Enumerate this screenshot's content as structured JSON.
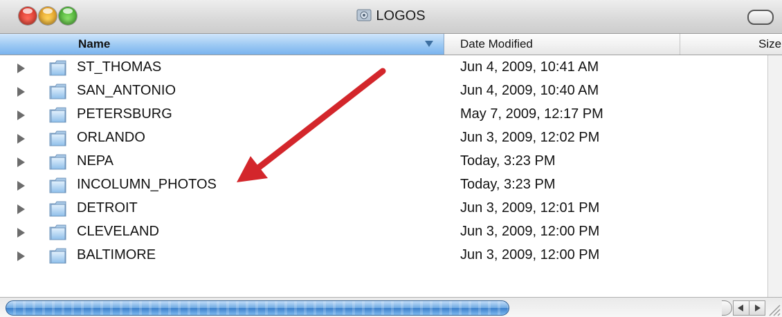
{
  "window": {
    "title": "LOGOS",
    "title_icon": "folder-window-icon"
  },
  "columns": {
    "name": "Name",
    "date_modified": "Date Modified",
    "size": "Size"
  },
  "rows": [
    {
      "name": "ST_THOMAS",
      "date": "Jun 4, 2009, 10:41 AM"
    },
    {
      "name": "SAN_ANTONIO",
      "date": "Jun 4, 2009, 10:40 AM"
    },
    {
      "name": "PETERSBURG",
      "date": "May 7, 2009, 12:17 PM"
    },
    {
      "name": "ORLANDO",
      "date": "Jun 3, 2009, 12:02 PM"
    },
    {
      "name": "NEPA",
      "date": "Today, 3:23 PM"
    },
    {
      "name": "INCOLUMN_PHOTOS",
      "date": "Today, 3:23 PM"
    },
    {
      "name": "DETROIT",
      "date": "Jun 3, 2009, 12:01 PM"
    },
    {
      "name": "CLEVELAND",
      "date": "Jun 3, 2009, 12:00 PM"
    },
    {
      "name": "BALTIMORE",
      "date": "Jun 3, 2009, 12:00 PM"
    }
  ],
  "icons": {
    "row_folder": "folder-icon",
    "row_disclosure": "disclosure-triangle-icon",
    "sort": "sort-descending-icon"
  },
  "colors": {
    "annotation_arrow": "#d3262b",
    "header_selected": "#9cc9f3",
    "close": "#e0443a",
    "minimize": "#f0b12c",
    "zoom": "#4cbb2e"
  }
}
